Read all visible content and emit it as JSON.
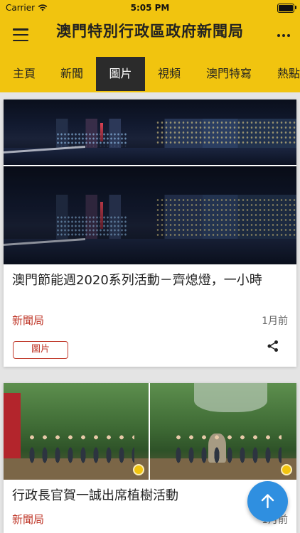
{
  "status_bar": {
    "carrier": "Carrier",
    "time": "5:05 PM"
  },
  "header": {
    "title": "澳門特別行政區政府新聞局",
    "menu_icon": "menu-icon",
    "more_icon": "more-icon"
  },
  "tabs": [
    {
      "label": "主頁",
      "active": false
    },
    {
      "label": "新聞",
      "active": false
    },
    {
      "label": "圖片",
      "active": true
    },
    {
      "label": "視頻",
      "active": false
    },
    {
      "label": "澳門特寫",
      "active": false
    },
    {
      "label": "熱點",
      "active": false
    }
  ],
  "cards": [
    {
      "title": "澳門節能週2020系列活動－齊熄燈，一小時",
      "source": "新聞局",
      "time_ago": "1月前",
      "tag": "圖片",
      "share_icon": "share-icon"
    },
    {
      "title": "行政長官賀一誠出席植樹活動",
      "source": "新聞局",
      "time_ago": "1月前"
    }
  ],
  "fab": {
    "icon": "arrow-up-icon"
  },
  "colors": {
    "accent": "#f1c40f",
    "active_tab": "#2b2b2b",
    "source_red": "#c0392b",
    "fab_blue": "#2f8fe0"
  }
}
